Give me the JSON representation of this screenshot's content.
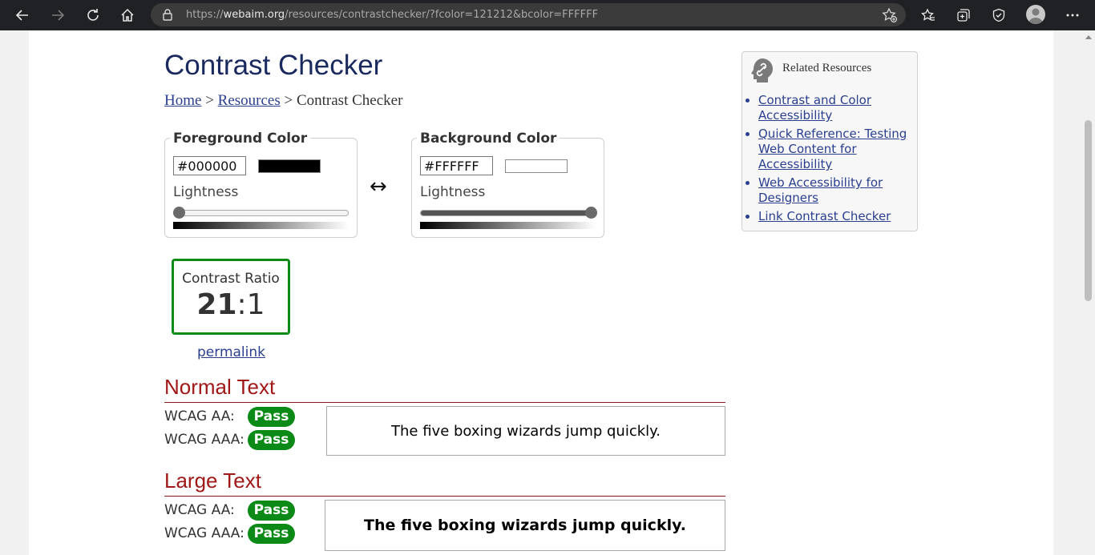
{
  "browser": {
    "url_prefix": "https://",
    "url_domain": "webaim.org",
    "url_path": "/resources/contrastchecker/?fcolor=121212&bcolor=FFFFFF"
  },
  "page": {
    "title": "Contrast Checker",
    "breadcrumb": {
      "home": "Home",
      "sep1": ">",
      "resources": "Resources",
      "sep2": ">",
      "current": "Contrast Checker"
    }
  },
  "foreground": {
    "legend": "Foreground Color",
    "hex": "#000000",
    "swatch_color": "#000000",
    "lightness_label": "Lightness",
    "lightness": 0
  },
  "background": {
    "legend": "Background Color",
    "hex": "#FFFFFF",
    "swatch_color": "#FFFFFF",
    "lightness_label": "Lightness",
    "lightness": 1
  },
  "swap_symbol": "↔",
  "contrast": {
    "label": "Contrast Ratio",
    "value_major": "21",
    "value_minor": ":1",
    "permalink": "permalink"
  },
  "normal_text": {
    "heading": "Normal Text",
    "aa_label": "WCAG AA:",
    "aa_result": "Pass",
    "aaa_label": "WCAG AAA:",
    "aaa_result": "Pass",
    "sample": "The five boxing wizards jump quickly."
  },
  "large_text": {
    "heading": "Large Text",
    "aa_label": "WCAG AA:",
    "aa_result": "Pass",
    "aaa_label": "WCAG AAA:",
    "aaa_result": "Pass",
    "sample": "The five boxing wizards jump quickly."
  },
  "related": {
    "heading": "Related Resources",
    "links": [
      "Contrast and Color Accessibility",
      "Quick Reference: Testing Web Content for Accessibility",
      "Web Accessibility for Designers",
      "Link Contrast Checker"
    ]
  },
  "colors": {
    "pass": "#0b8a18",
    "section": "#a01818",
    "link": "#2a3f8f",
    "title": "#1a2a5e"
  }
}
